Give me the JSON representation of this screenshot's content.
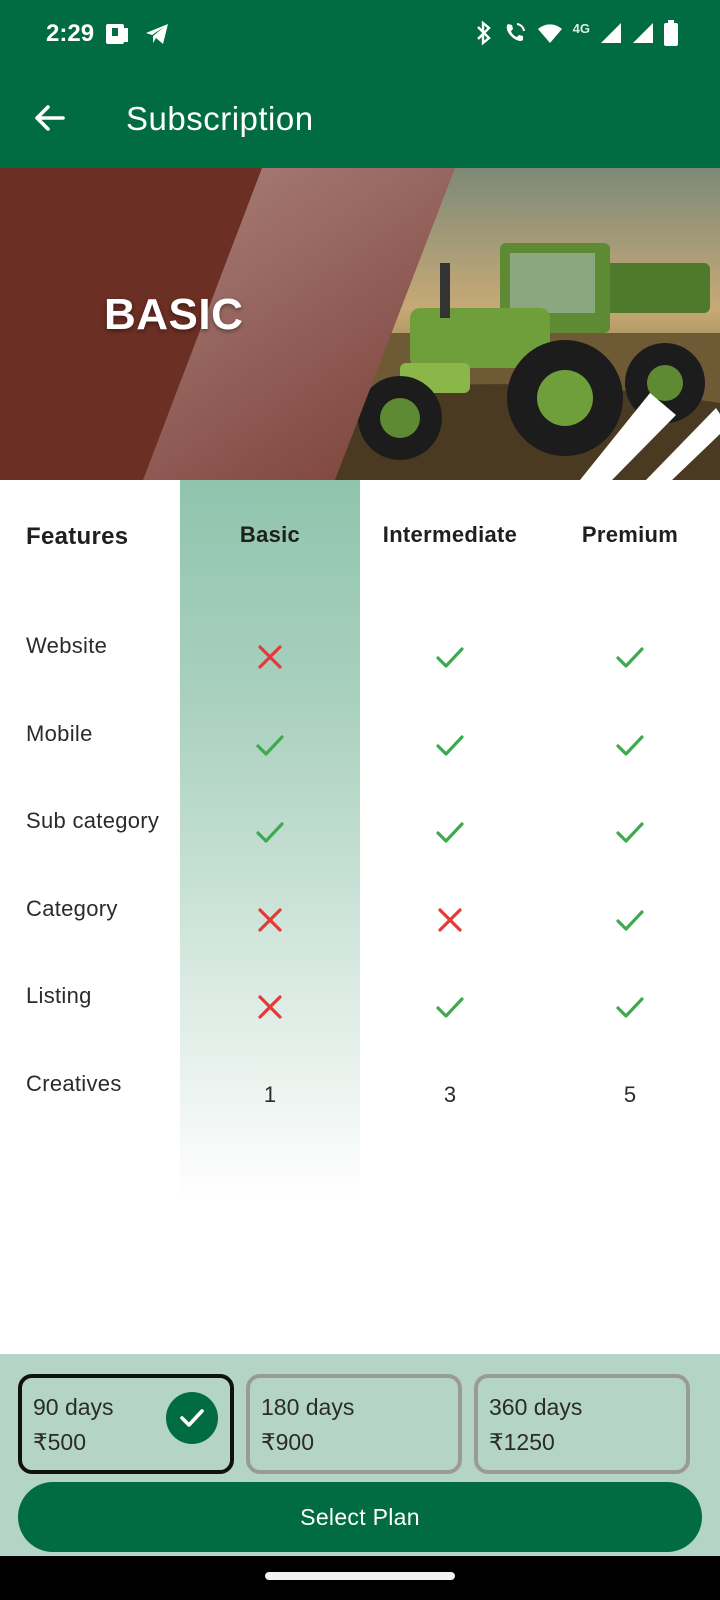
{
  "status_bar": {
    "time": "2:29",
    "network": "4G"
  },
  "app_bar": {
    "title": "Subscription"
  },
  "banner": {
    "title": "BASIC"
  },
  "table": {
    "headers": [
      "Features",
      "Basic",
      "Intermediate",
      "Premium"
    ],
    "rows": [
      {
        "label": "Website",
        "basic": "cross",
        "intermediate": "check",
        "premium": "check"
      },
      {
        "label": "Mobile",
        "basic": "check",
        "intermediate": "check",
        "premium": "check"
      },
      {
        "label": "Sub category",
        "basic": "check",
        "intermediate": "check",
        "premium": "check"
      },
      {
        "label": "Category",
        "basic": "cross",
        "intermediate": "cross",
        "premium": "check"
      },
      {
        "label": "Listing",
        "basic": "cross",
        "intermediate": "check",
        "premium": "check"
      },
      {
        "label": "Creatives",
        "basic": "1",
        "intermediate": "3",
        "premium": "5"
      }
    ]
  },
  "plans": [
    {
      "days": "90 days",
      "price": "₹500",
      "selected": true
    },
    {
      "days": "180 days",
      "price": "₹900",
      "selected": false
    },
    {
      "days": "360 days",
      "price": "₹1250",
      "selected": false
    }
  ],
  "select_button": {
    "label": "Select Plan"
  },
  "colors": {
    "primary": "#016b41",
    "check": "#3daa4f",
    "cross": "#e53935",
    "panel": "#b4d5c6",
    "banner_dark": "#6b2f23"
  },
  "icons": {
    "check": "check-icon",
    "cross": "cross-icon",
    "back": "arrow-left-icon"
  }
}
